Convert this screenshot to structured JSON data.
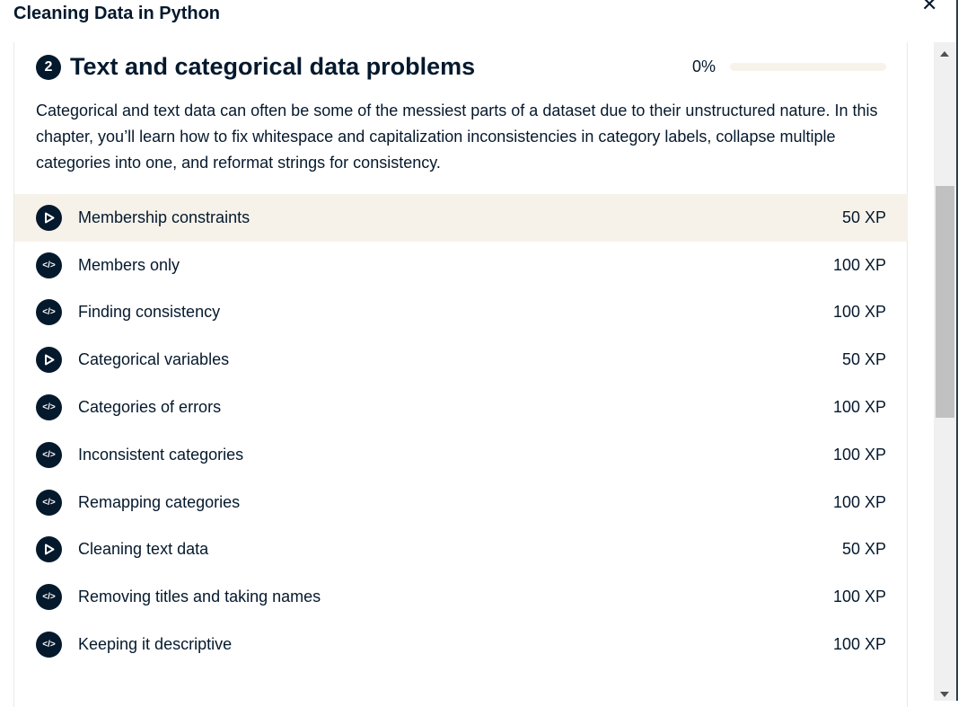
{
  "window": {
    "title": "Cleaning Data in Python",
    "close_icon": "close-icon"
  },
  "chapter": {
    "number": "2",
    "title": "Text and categorical data problems",
    "progress_label": "0%",
    "progress": 0,
    "description": "Categorical and text data can often be some of the messiest parts of a dataset due to their unstructured nature. In this chapter, you’ll learn how to fix whitespace and capitalization inconsistencies in category labels, collapse multiple categories into one, and reformat strings for consistency."
  },
  "exercises": [
    {
      "type": "video",
      "label": "Membership constraints",
      "xp": "50 XP"
    },
    {
      "type": "code",
      "label": "Members only",
      "xp": "100 XP"
    },
    {
      "type": "code",
      "label": "Finding consistency",
      "xp": "100 XP"
    },
    {
      "type": "video",
      "label": "Categorical variables",
      "xp": "50 XP"
    },
    {
      "type": "code",
      "label": "Categories of errors",
      "xp": "100 XP"
    },
    {
      "type": "code",
      "label": "Inconsistent categories",
      "xp": "100 XP"
    },
    {
      "type": "code",
      "label": "Remapping categories",
      "xp": "100 XP"
    },
    {
      "type": "video",
      "label": "Cleaning text data",
      "xp": "50 XP"
    },
    {
      "type": "code",
      "label": "Removing titles and taking names",
      "xp": "100 XP"
    },
    {
      "type": "code",
      "label": "Keeping it descriptive",
      "xp": "100 XP"
    }
  ]
}
